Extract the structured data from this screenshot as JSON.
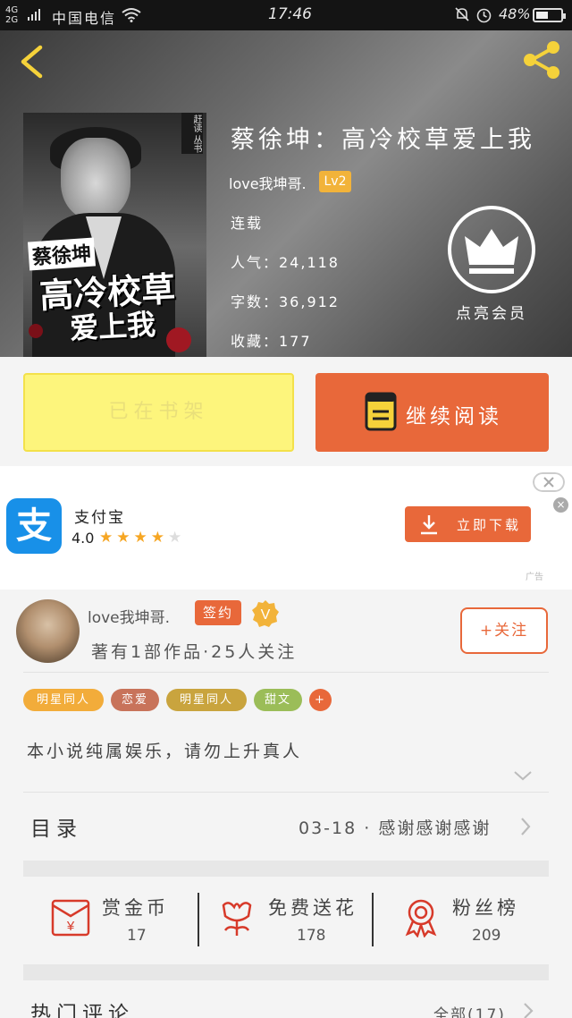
{
  "status_bar": {
    "network": "4G",
    "network2": "2G",
    "carrier": "中国电信",
    "time": "17:46",
    "battery": "48%"
  },
  "header": {
    "back_icon": "back-icon",
    "share_icon": "share-icon",
    "cover_publisher": "赶读 丛书",
    "cover_line1": "蔡徐坤",
    "cover_line2": "高冷校草",
    "cover_line3": "爱上我",
    "title": "蔡徐坤：高冷校草爱上我",
    "author": "love我坤哥.",
    "level": "Lv2",
    "status": "连载",
    "popularity": "人气：24,118",
    "word_count": "字数：36,912",
    "favorites": "收藏：177",
    "vip_label": "点亮会员"
  },
  "actions": {
    "shelf_label": "已在书架",
    "read_label": "继续阅读"
  },
  "ad": {
    "app_name": "支付宝",
    "logo_text": "支",
    "rating": "4.0",
    "stars_on": "★★★★",
    "stars_off": "★",
    "download_label": "立即下载",
    "close_label": "×",
    "ad_tag": "广告"
  },
  "author_card": {
    "name": "love我坤哥.",
    "signed_badge": "签约",
    "v_badge": "V",
    "info": "著有1部作品·25人关注",
    "follow_label": "+关注"
  },
  "tags": [
    {
      "label": "明星同人",
      "color": "#f2ac3a"
    },
    {
      "label": "恋爱",
      "color": "#c8735a"
    },
    {
      "label": "明星同人",
      "color": "#c9a43e"
    },
    {
      "label": "甜文",
      "color": "#9bbd58"
    },
    {
      "label": "+",
      "color": "#e8683a"
    }
  ],
  "intro": "本小说纯属娱乐，请勿上升真人",
  "toc": {
    "label": "目录",
    "latest": "03-18 · 感谢感谢感谢"
  },
  "stats": [
    {
      "label": "赏金币",
      "value": "17",
      "icon": "red-envelope-icon"
    },
    {
      "label": "免费送花",
      "value": "178",
      "icon": "flower-icon"
    },
    {
      "label": "粉丝榜",
      "value": "209",
      "icon": "medal-icon"
    }
  ],
  "hot_comments": {
    "label": "热门评论",
    "all_label": "全部(17)"
  },
  "colors": {
    "accent": "#e8683a",
    "shelf_yellow": "#fdf57c",
    "lv_badge": "#f2b33a",
    "alipay_blue": "#1890e8"
  }
}
